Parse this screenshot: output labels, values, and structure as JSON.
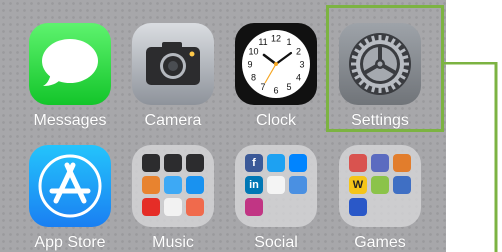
{
  "apps": [
    {
      "label": "Messages",
      "icon": "messages-icon",
      "colors": [
        "#5ef36e",
        "#13c52a"
      ]
    },
    {
      "label": "Camera",
      "icon": "camera-icon",
      "colors": [
        "#dadde1",
        "#8e939b"
      ]
    },
    {
      "label": "Clock",
      "icon": "clock-icon",
      "colors": [
        "#1b1b1b",
        "#000000"
      ]
    },
    {
      "label": "Settings",
      "icon": "settings-gear-icon",
      "colors": [
        "#9ea3a9",
        "#707479"
      ]
    },
    {
      "label": "App Store",
      "icon": "app-store-icon",
      "colors": [
        "#24c4fc",
        "#1a7ff2"
      ]
    },
    {
      "label": "Music",
      "icon": "music-folder-icon"
    },
    {
      "label": "Social",
      "icon": "social-folder-icon"
    },
    {
      "label": "Games",
      "icon": "games-folder-icon"
    }
  ],
  "clock": {
    "numerals": [
      "12",
      "1",
      "2",
      "3",
      "4",
      "5",
      "6",
      "7",
      "8",
      "9",
      "10",
      "11"
    ],
    "time": "10:10"
  },
  "folders": {
    "music": [
      {
        "icon": "music-app-icon",
        "color": "#2c2c2e"
      },
      {
        "icon": "music-app-icon",
        "color": "#2c2c2e"
      },
      {
        "icon": "music-app-icon",
        "color": "#2c2c2e"
      },
      {
        "icon": "burger-app-icon",
        "color": "#e8832f"
      },
      {
        "icon": "list-app-icon",
        "color": "#3da9f5"
      },
      {
        "icon": "shazam-icon",
        "color": "#1992f0"
      },
      {
        "icon": "youtube-icon",
        "color": "#e52d27"
      },
      {
        "icon": "tidal-icon",
        "color": "#f2f2f2"
      },
      {
        "icon": "target-app-icon",
        "color": "#f06a4c"
      }
    ],
    "social": [
      {
        "icon": "facebook-icon",
        "color": "#3b5998",
        "glyph": "f"
      },
      {
        "icon": "twitter-icon",
        "color": "#1da1f2"
      },
      {
        "icon": "messenger-icon",
        "color": "#0084ff"
      },
      {
        "icon": "linkedin-icon",
        "color": "#0077b5",
        "glyph": "in"
      },
      {
        "icon": "delta-app-icon",
        "color": "#f4f4f4"
      },
      {
        "icon": "download-app-icon",
        "color": "#4a90e2"
      },
      {
        "icon": "instagram-icon",
        "color": "#c13584"
      }
    ],
    "games": [
      {
        "icon": "game-icon",
        "color": "#d9534f"
      },
      {
        "icon": "game-icon",
        "color": "#5b6bc0"
      },
      {
        "icon": "game-icon",
        "color": "#e27d2c"
      },
      {
        "icon": "words-game-icon",
        "color": "#f5c518",
        "glyph": "W"
      },
      {
        "icon": "flower-game-icon",
        "color": "#8bc34a"
      },
      {
        "icon": "card-game-icon",
        "color": "#3f6fc4"
      },
      {
        "icon": "star-game-icon",
        "color": "#2a58c8"
      }
    ]
  },
  "highlight": {
    "color": "#7cb342",
    "target": "Settings"
  }
}
